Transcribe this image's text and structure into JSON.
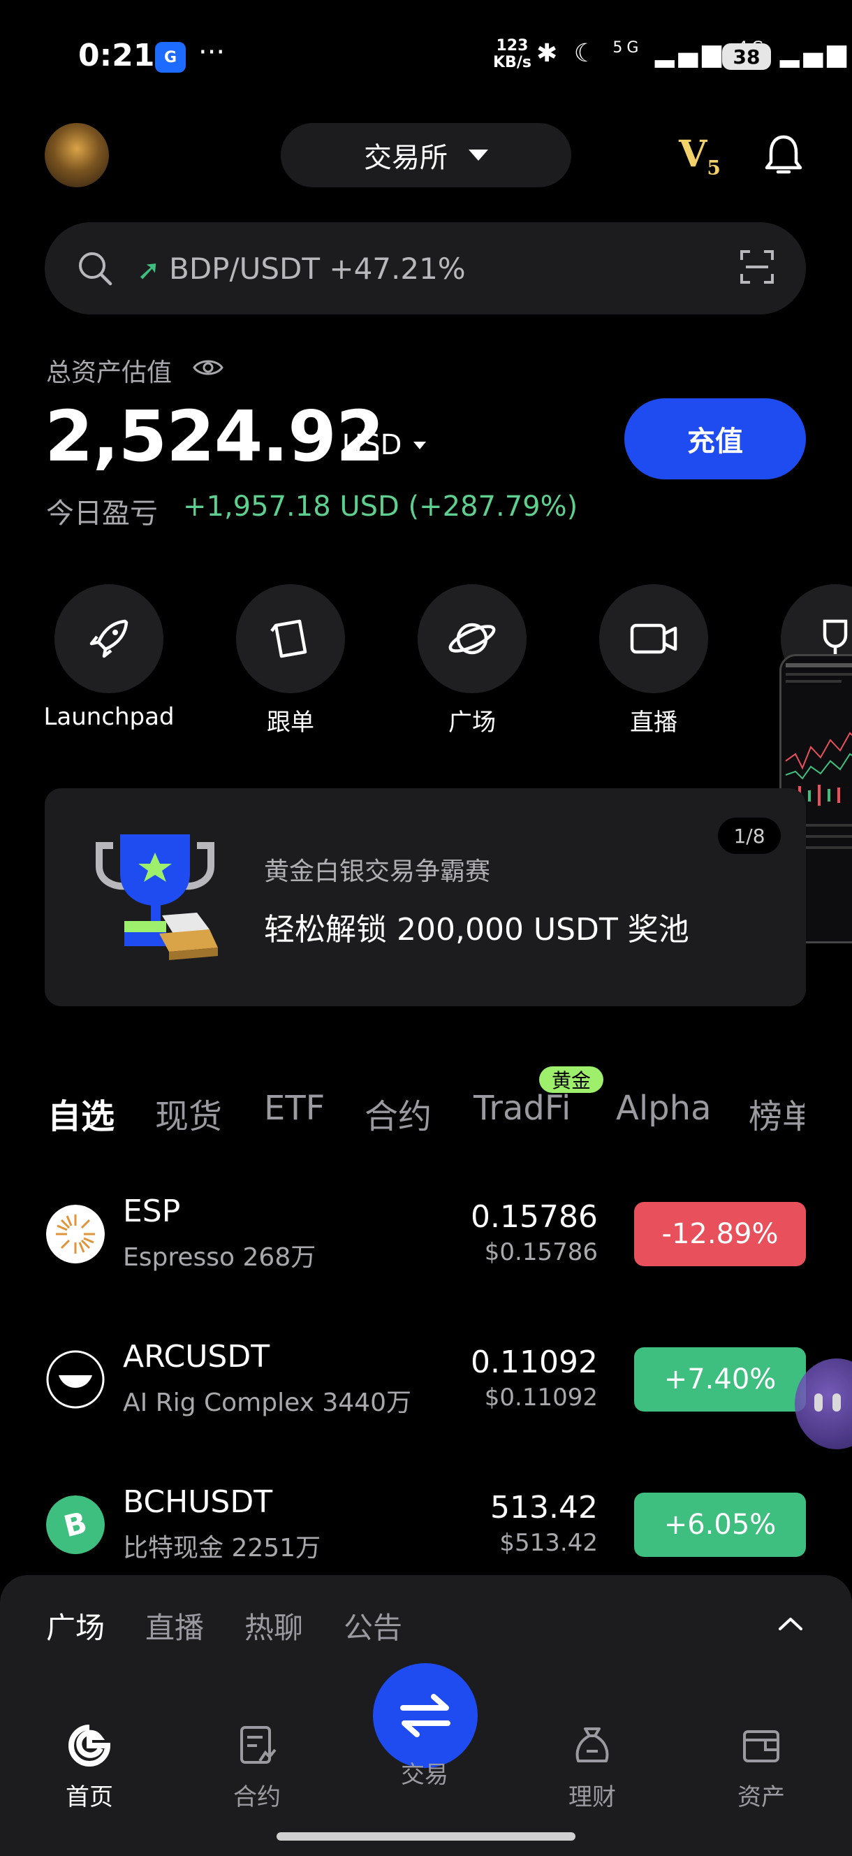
{
  "status_bar": {
    "time": "0:21",
    "app_badge": "G",
    "more": "···",
    "net_speed_value": "123",
    "net_speed_unit": "KB/s",
    "signal_1": "5G",
    "signal_2": "4G",
    "battery": "38"
  },
  "header": {
    "exchange_label": "交易所",
    "vip_level": "V",
    "vip_num": "5"
  },
  "search": {
    "ticker": "BDP/USDT +47.21%"
  },
  "assets": {
    "label": "总资产估值",
    "value": "2,524.92",
    "unit": "USD",
    "deposit_label": "充值",
    "pnl_label": "今日盈亏",
    "pnl_value": "+1,957.18 USD (+287.79%)"
  },
  "shortcuts": [
    {
      "label": "Launchpad"
    },
    {
      "label": "跟单"
    },
    {
      "label": "广场"
    },
    {
      "label": "直播"
    }
  ],
  "banner": {
    "subtitle": "黄金白银交易争霸赛",
    "title": "轻松解锁 200,000 USDT 奖池",
    "page": "1/8"
  },
  "market_tabs": [
    {
      "label": "自选"
    },
    {
      "label": "现货"
    },
    {
      "label": "ETF"
    },
    {
      "label": "合约"
    },
    {
      "label": "TradFi"
    },
    {
      "label": "Alpha"
    },
    {
      "label": "榜单"
    }
  ],
  "tradfi_badge": "黄金",
  "coins": [
    {
      "symbol": "ESP",
      "name": "Espresso",
      "volume": "268万",
      "price": "0.15786",
      "usd": "$0.15786",
      "change": "-12.89%"
    },
    {
      "symbol": "ARCUSDT",
      "name": "AI Rig Complex",
      "volume": "3440万",
      "price": "0.11092",
      "usd": "$0.11092",
      "change": "+7.40%"
    },
    {
      "symbol": "BCHUSDT",
      "name": "比特现金",
      "volume": "2251万",
      "price": "513.42",
      "usd": "$513.42",
      "change": "+6.05%"
    }
  ],
  "feed_tabs": [
    {
      "label": "广场"
    },
    {
      "label": "直播"
    },
    {
      "label": "热聊"
    },
    {
      "label": "公告"
    }
  ],
  "bottom_nav": [
    {
      "label": "首页"
    },
    {
      "label": "合约"
    },
    {
      "label": "交易"
    },
    {
      "label": "理财"
    },
    {
      "label": "资产"
    }
  ],
  "colors": {
    "accent": "#1f4cf0",
    "positive": "#3fbf7f",
    "negative": "#e8505b",
    "badge": "#9ef06c",
    "vip": "#f3d16a"
  }
}
